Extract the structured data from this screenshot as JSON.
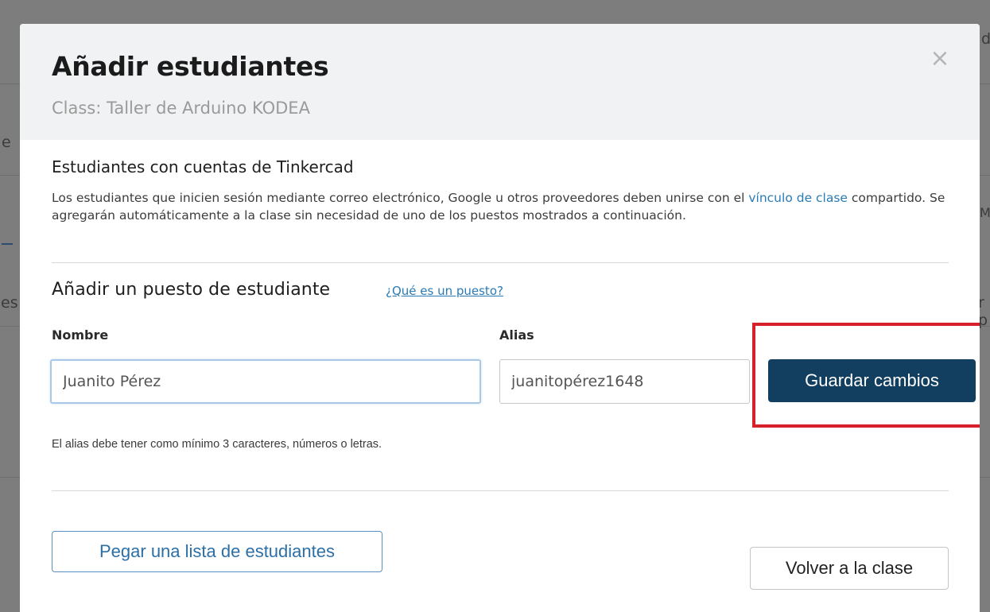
{
  "background": {
    "fragments": [
      "d",
      "e",
      "es",
      "M",
      "r p"
    ]
  },
  "modal": {
    "title": "Añadir estudiantes",
    "subtitle": "Class: Taller de Arduino KODEA",
    "close_label": "×"
  },
  "accounts_section": {
    "title": "Estudiantes con cuentas de Tinkercad",
    "desc_before": "Los estudiantes que inicien sesión mediante correo electrónico, Google u otros proveedores deben unirse con el ",
    "desc_link": "vínculo de clase",
    "desc_after": " compartido. Se agregarán automáticamente a la clase sin necesidad de uno de los puestos mostrados a continuación."
  },
  "add_seat": {
    "title": "Añadir un puesto de estudiante",
    "help_link": "¿Qué es un puesto?",
    "name_label": "Nombre",
    "name_value": "Juanito Pérez",
    "alias_label": "Alias",
    "alias_value": "juanitopérez1648",
    "save_button": "Guardar cambios",
    "hint": "El alias debe tener como mínimo 3 caracteres, números o letras."
  },
  "footer": {
    "paste_button": "Pegar una lista de estudiantes",
    "back_button": "Volver a la clase"
  },
  "colors": {
    "primary": "#123f60",
    "link": "#2a7bb5",
    "highlight": "#d6212b"
  }
}
